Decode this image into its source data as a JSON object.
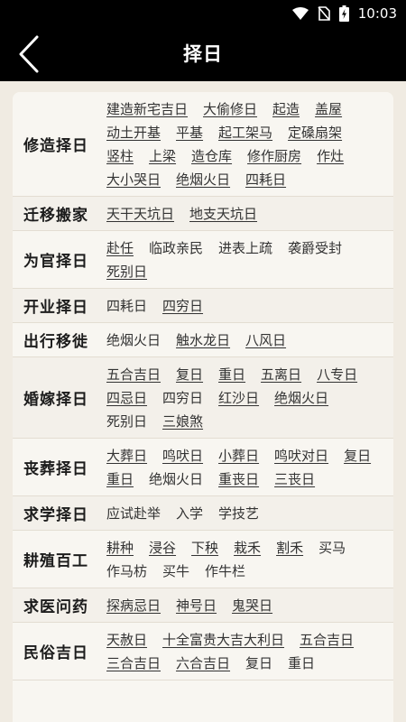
{
  "status": {
    "time": "10:03"
  },
  "header": {
    "title": "择日"
  },
  "categories": [
    {
      "name": "修造择日",
      "items": [
        {
          "t": "建造新宅吉日",
          "link": true
        },
        {
          "t": "大偷修日",
          "link": true
        },
        {
          "t": "起造",
          "link": true
        },
        {
          "t": "盖屋",
          "link": true
        },
        {
          "t": "动土开基",
          "link": true
        },
        {
          "t": "平基",
          "link": true
        },
        {
          "t": "起工架马",
          "link": true
        },
        {
          "t": "定磉扇架",
          "link": true
        },
        {
          "t": "竖柱",
          "link": true
        },
        {
          "t": "上梁",
          "link": true
        },
        {
          "t": "造仓库",
          "link": true
        },
        {
          "t": "修作厨房",
          "link": true
        },
        {
          "t": "作灶",
          "link": true
        },
        {
          "t": "大小哭日",
          "link": true
        },
        {
          "t": "绝烟火日",
          "link": true
        },
        {
          "t": "四耗日",
          "link": true
        }
      ]
    },
    {
      "name": "迁移搬家",
      "items": [
        {
          "t": "天干天坑日",
          "link": true
        },
        {
          "t": "地支天坑日",
          "link": true
        }
      ]
    },
    {
      "name": "为官择日",
      "items": [
        {
          "t": "赴任",
          "link": true
        },
        {
          "t": "临政亲民",
          "link": false
        },
        {
          "t": "进表上疏",
          "link": false
        },
        {
          "t": "袭爵受封",
          "link": false
        },
        {
          "t": "死别日",
          "link": true
        }
      ]
    },
    {
      "name": "开业择日",
      "items": [
        {
          "t": "四耗日",
          "link": false
        },
        {
          "t": "四穷日",
          "link": true
        }
      ]
    },
    {
      "name": "出行移徙",
      "items": [
        {
          "t": "绝烟火日",
          "link": false
        },
        {
          "t": "触水龙日",
          "link": true
        },
        {
          "t": "八风日",
          "link": true
        }
      ]
    },
    {
      "name": "婚嫁择日",
      "items": [
        {
          "t": "五合吉日",
          "link": true
        },
        {
          "t": "复日",
          "link": true
        },
        {
          "t": "重日",
          "link": true
        },
        {
          "t": "五离日",
          "link": true
        },
        {
          "t": "八专日",
          "link": true
        },
        {
          "t": "四忌日",
          "link": true
        },
        {
          "t": "四穷日",
          "link": false
        },
        {
          "t": "红沙日",
          "link": true
        },
        {
          "t": "绝烟火日",
          "link": true
        },
        {
          "t": "死别日",
          "link": false
        },
        {
          "t": "三娘煞",
          "link": true
        }
      ]
    },
    {
      "name": "丧葬择日",
      "items": [
        {
          "t": "大葬日",
          "link": true
        },
        {
          "t": "鸣吠日",
          "link": true
        },
        {
          "t": "小葬日",
          "link": true
        },
        {
          "t": "鸣吠对日",
          "link": true
        },
        {
          "t": "复日",
          "link": true
        },
        {
          "t": "重日",
          "link": true
        },
        {
          "t": "绝烟火日",
          "link": false
        },
        {
          "t": "重丧日",
          "link": true
        },
        {
          "t": "三丧日",
          "link": true
        }
      ]
    },
    {
      "name": "求学择日",
      "items": [
        {
          "t": "应试赴举",
          "link": false
        },
        {
          "t": "入学",
          "link": false
        },
        {
          "t": "学技艺",
          "link": false
        }
      ]
    },
    {
      "name": "耕殖百工",
      "items": [
        {
          "t": "耕种",
          "link": true
        },
        {
          "t": "浸谷",
          "link": true
        },
        {
          "t": "下秧",
          "link": true
        },
        {
          "t": "栽禾",
          "link": true
        },
        {
          "t": "割禾",
          "link": true
        },
        {
          "t": "买马",
          "link": false
        },
        {
          "t": "作马枋",
          "link": false
        },
        {
          "t": "买牛",
          "link": false
        },
        {
          "t": "作牛栏",
          "link": false
        }
      ]
    },
    {
      "name": "求医问药",
      "items": [
        {
          "t": "探病忌日",
          "link": true
        },
        {
          "t": "神号日",
          "link": true
        },
        {
          "t": "鬼哭日",
          "link": true
        }
      ]
    },
    {
      "name": "民俗吉日",
      "items": [
        {
          "t": "天赦日",
          "link": true
        },
        {
          "t": "十全富贵大吉大利日",
          "link": true
        },
        {
          "t": "五合吉日",
          "link": true
        },
        {
          "t": "三合吉日",
          "link": true
        },
        {
          "t": "六合吉日",
          "link": true
        },
        {
          "t": "复日",
          "link": false
        },
        {
          "t": "重日",
          "link": false
        }
      ]
    }
  ]
}
